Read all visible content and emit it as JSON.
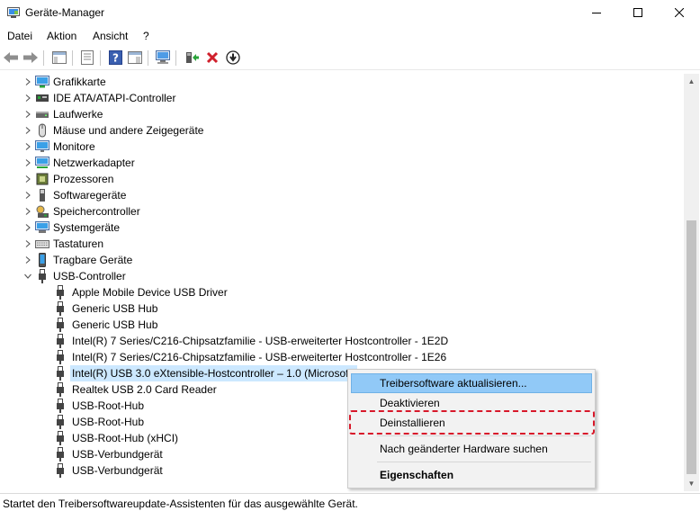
{
  "window": {
    "title": "Geräte-Manager",
    "minimize_icon": "minimize-icon",
    "maximize_icon": "maximize-icon",
    "close_icon": "close-icon"
  },
  "menubar": {
    "items": [
      "Datei",
      "Aktion",
      "Ansicht",
      "?"
    ]
  },
  "toolbar": {
    "icons": [
      "back-arrow-icon",
      "forward-arrow-icon",
      "show-hide-tree-icon",
      "properties-icon",
      "help-icon",
      "action-pane-icon",
      "scan-hardware-icon",
      "update-driver-icon",
      "uninstall-x-icon",
      "disable-device-icon"
    ]
  },
  "tree": {
    "categories": [
      {
        "label": "Grafikkarte",
        "icon": "display-adapter-icon"
      },
      {
        "label": "IDE ATA/ATAPI-Controller",
        "icon": "ide-controller-icon"
      },
      {
        "label": "Laufwerke",
        "icon": "disk-drive-icon"
      },
      {
        "label": "Mäuse und andere Zeigegeräte",
        "icon": "mouse-icon"
      },
      {
        "label": "Monitore",
        "icon": "monitor-icon"
      },
      {
        "label": "Netzwerkadapter",
        "icon": "network-adapter-icon"
      },
      {
        "label": "Prozessoren",
        "icon": "processor-icon"
      },
      {
        "label": "Softwaregeräte",
        "icon": "software-device-icon"
      },
      {
        "label": "Speichercontroller",
        "icon": "storage-controller-icon"
      },
      {
        "label": "Systemgeräte",
        "icon": "system-devices-icon"
      },
      {
        "label": "Tastaturen",
        "icon": "keyboard-icon"
      },
      {
        "label": "Tragbare Geräte",
        "icon": "portable-device-icon"
      },
      {
        "label": "USB-Controller",
        "icon": "usb-controller-icon",
        "expanded": true
      }
    ],
    "usb_children": [
      "Apple Mobile Device USB Driver",
      "Generic USB Hub",
      "Generic USB Hub",
      "Intel(R) 7 Series/C216-Chipsatzfamilie - USB-erweiterter Hostcontroller - 1E2D",
      "Intel(R) 7 Series/C216-Chipsatzfamilie - USB-erweiterter Hostcontroller - 1E26",
      "Intel(R) USB 3.0 eXtensible-Hostcontroller – 1.0 (Microsoft)",
      "Realtek USB 2.0 Card Reader",
      "USB-Root-Hub",
      "USB-Root-Hub",
      "USB-Root-Hub (xHCI)",
      "USB-Verbundgerät",
      "USB-Verbundgerät"
    ],
    "selected_child_index": 5
  },
  "context_menu": {
    "items": [
      {
        "label": "Treibersoftware aktualisieren..."
      },
      {
        "label": "Deaktivieren"
      },
      {
        "label": "Deinstallieren"
      },
      {
        "label": "Nach geänderter Hardware suchen"
      },
      {
        "label": "Eigenschaften"
      }
    ],
    "hovered_index": 0,
    "bold_index": 4,
    "highlight_color": "#d8182a"
  },
  "statusbar": {
    "text": "Startet den Treibersoftwareupdate-Assistenten für das ausgewählte Gerät."
  },
  "colors": {
    "selection": "#cce8ff",
    "menu_hover": "#91c9f7",
    "uninstall_red": "#d0202c"
  }
}
